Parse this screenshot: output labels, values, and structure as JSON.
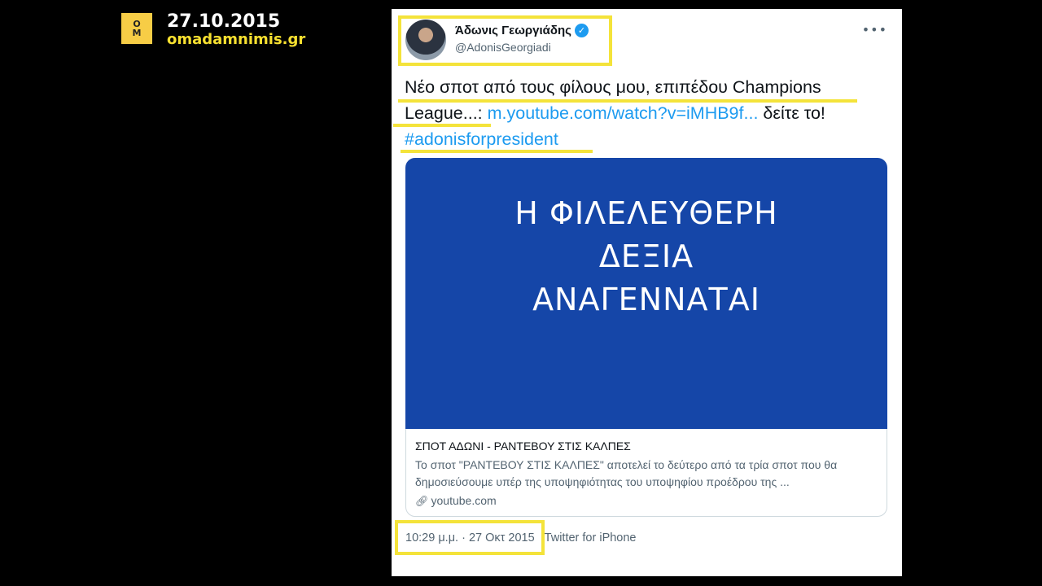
{
  "overlay": {
    "logo_top": "O",
    "logo_bottom": "M",
    "date": "27.10.2015",
    "site": "omadamnimis.gr",
    "highlight_color": "#f4e33a"
  },
  "tweet": {
    "author_name": "Άδωνις Γεωργιάδης",
    "handle": "@AdonisGeorgiadi",
    "verified_icon": "verified-badge",
    "more_icon": "more-options",
    "text_part1": "Νέο σποτ από τους φίλους μου, επιπέδου Champions League...: ",
    "link_text": "m.youtube.com/watch?v=iMHB9f...",
    "text_part2": " δείτε το!",
    "hashtag": "#adonisforpresident",
    "media": {
      "line1": "Η ΦΙΛΕΛΕΥΘΕΡΗ",
      "line2": "ΔΕΞΙΑ",
      "line3": "ΑΝΑΓΕΝΝΑΤΑΙ",
      "background": "#1546a8"
    },
    "card": {
      "title": "ΣΠΟΤ ΑΔΩΝΙ - ΡΑΝΤΕΒΟΥ ΣΤΙΣ ΚΑΛΠΕΣ",
      "description": "Το σποτ \"ΡΑΝΤΕΒΟΥ ΣΤΙΣ ΚΑΛΠΕΣ\" αποτελεί το δεύτερο από τα τρία σποτ που θα δημοσιεύσουμε υπέρ της υποψηφιότητας του υποψηφίου προέδρου της ...",
      "domain": "youtube.com",
      "domain_icon": "link-icon"
    },
    "timestamp": "10:29 μ.μ. · 27 Οκτ 2015",
    "source": "Twitter for iPhone"
  }
}
